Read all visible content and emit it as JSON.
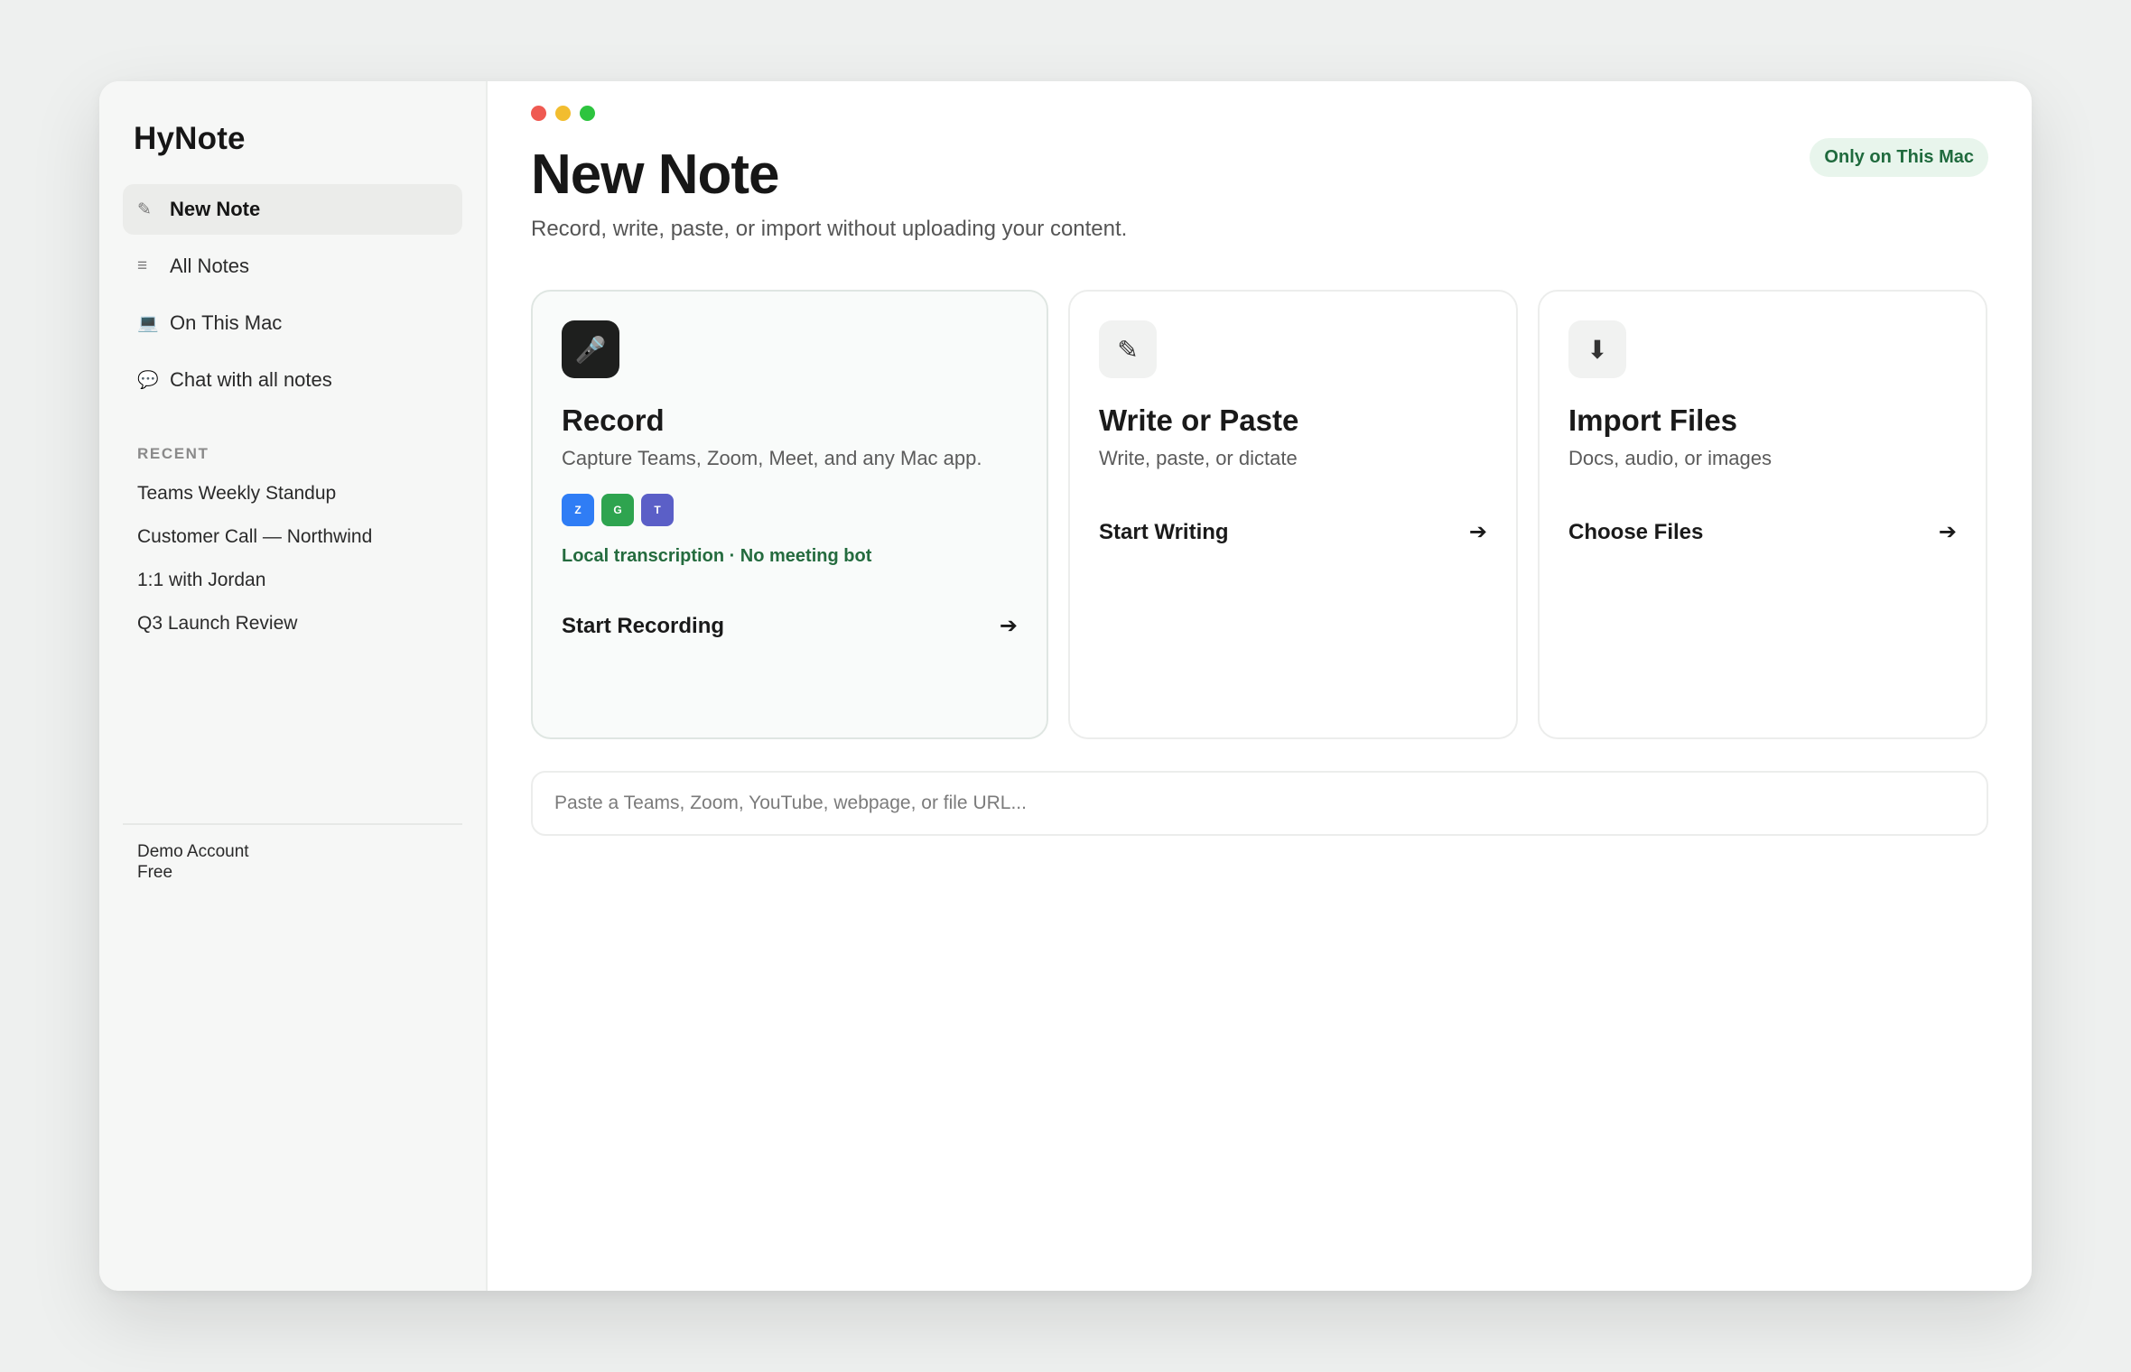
{
  "app": {
    "title": "HyNote"
  },
  "sidebar": {
    "nav": [
      {
        "label": "New Note",
        "icon": "✎",
        "icon_name": "pencil-icon",
        "active": true
      },
      {
        "label": "All Notes",
        "icon": "≡",
        "icon_name": "list-icon",
        "active": false
      },
      {
        "label": "On This Mac",
        "icon": "💻",
        "icon_name": "laptop-icon",
        "active": false
      },
      {
        "label": "Chat with all notes",
        "icon": "💬",
        "icon_name": "chat-bubble-icon",
        "active": false
      }
    ],
    "recent_heading": "RECENT",
    "recent": [
      "Teams Weekly Standup",
      "Customer Call — Northwind",
      "1:1 with Jordan",
      "Q3 Launch Review"
    ],
    "account": {
      "name": "Demo Account",
      "plan": "Free"
    }
  },
  "main": {
    "title": "New Note",
    "subtitle": "Record, write, paste, or import without uploading your content.",
    "badge": "Only on This Mac",
    "cards": {
      "record": {
        "icon": "🎤",
        "icon_name": "microphone-icon",
        "title": "Record",
        "desc": "Capture Teams, Zoom, Meet, and any Mac app.",
        "apps": [
          {
            "letter": "Z",
            "color": "#2f7df5"
          },
          {
            "letter": "G",
            "color": "#2ea44f"
          },
          {
            "letter": "T",
            "color": "#5b5fc7"
          }
        ],
        "note": "Local transcription · No meeting bot",
        "action": "Start Recording"
      },
      "write": {
        "icon": "✎",
        "icon_name": "pencil-icon",
        "title": "Write or Paste",
        "desc": "Write, paste, or dictate",
        "action": "Start Writing"
      },
      "import": {
        "icon": "⬇",
        "icon_name": "download-icon",
        "title": "Import Files",
        "desc": "Docs, audio, or images",
        "action": "Choose Files"
      },
      "arrow": "➔"
    },
    "url_input": {
      "placeholder": "Paste a Teams, Zoom, YouTube, webpage, or file URL...",
      "value": ""
    }
  },
  "colors": {
    "accent_green": "#246b3e",
    "badge_bg": "#e8f5ec",
    "traffic_red": "#ef5a52",
    "traffic_yellow": "#f2bd2f",
    "traffic_green": "#2dc43f"
  }
}
